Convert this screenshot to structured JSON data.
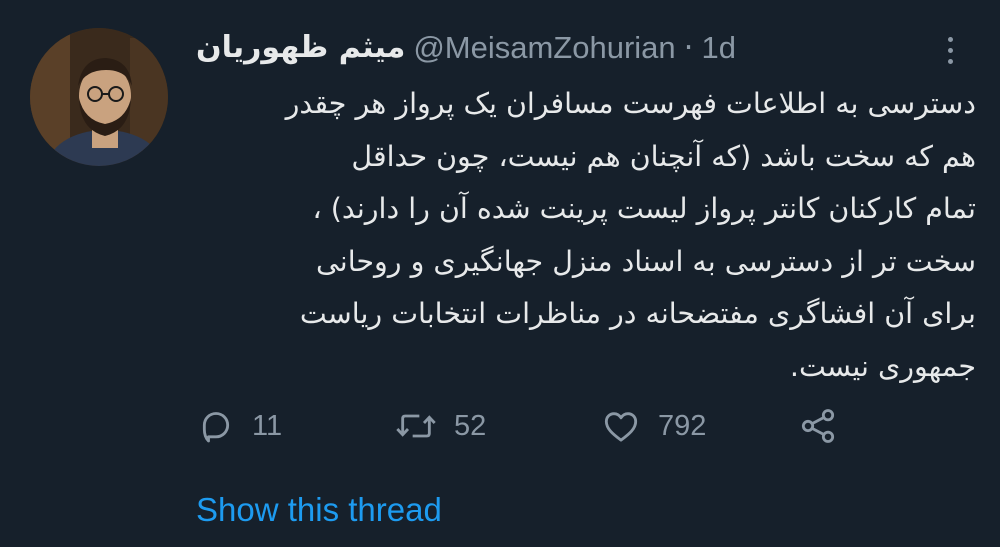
{
  "tweet": {
    "display_name": "میثم ظهوریان",
    "handle": "@MeisamZohurian",
    "separator": "·",
    "time": "1d",
    "text_lines": [
      "دسترسی به اطلاعات فهرست مسافران یک پرواز هر چقدر",
      "هم که سخت باشد (که آنچنان هم نیست، چون حداقل",
      "تمام کارکنان کانتر پرواز لیست پرینت شده آن را دارند) ،",
      "سخت تر از دسترسی به اسناد منزل جهانگیری و روحانی",
      "برای آن افشاگری مفتضحانه در مناظرات انتخابات ریاست",
      "جمهوری نیست."
    ],
    "reply_count": "11",
    "retweet_count": "52",
    "like_count": "792",
    "show_thread_label": "Show this thread"
  },
  "icons": {
    "more": "more-dots-icon",
    "reply": "reply-icon",
    "retweet": "retweet-icon",
    "like": "heart-icon",
    "share": "share-icon"
  },
  "colors": {
    "background": "#16202b",
    "text": "#e7e9ea",
    "muted": "#8b98a5",
    "link": "#1d9bf0"
  }
}
